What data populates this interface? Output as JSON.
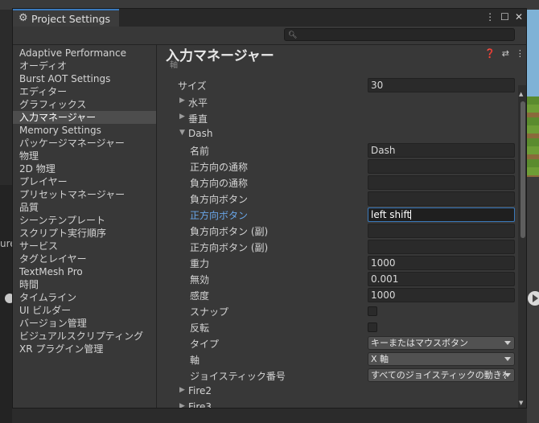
{
  "window": {
    "tab_title": "Project Settings",
    "search_placeholder": ""
  },
  "sidebar": {
    "items": [
      {
        "label": "Adaptive Performance"
      },
      {
        "label": "オーディオ"
      },
      {
        "label": "Burst AOT Settings"
      },
      {
        "label": "エディター"
      },
      {
        "label": "グラフィックス"
      },
      {
        "label": "入力マネージャー",
        "selected": true
      },
      {
        "label": "Memory Settings"
      },
      {
        "label": "パッケージマネージャー"
      },
      {
        "label": "物理"
      },
      {
        "label": "2D 物理"
      },
      {
        "label": "プレイヤー"
      },
      {
        "label": "プリセットマネージャー"
      },
      {
        "label": "品質"
      },
      {
        "label": "シーンテンプレート"
      },
      {
        "label": "スクリプト実行順序"
      },
      {
        "label": "サービス"
      },
      {
        "label": "タグとレイヤー"
      },
      {
        "label": "TextMesh Pro"
      },
      {
        "label": "時間"
      },
      {
        "label": "タイムライン"
      },
      {
        "label": "UI ビルダー"
      },
      {
        "label": "バージョン管理"
      },
      {
        "label": "ビジュアルスクリプティング"
      },
      {
        "label": "XR プラグイン管理"
      }
    ]
  },
  "content": {
    "title": "入力マネージャー",
    "axes_partial": "軸",
    "size_label": "サイズ",
    "size_value": "30",
    "horizontal_label": "水平",
    "vertical_label": "垂直",
    "dash_label": "Dash",
    "fields": {
      "name": {
        "label": "名前",
        "value": "Dash"
      },
      "positive_alias": {
        "label": "正方向の通称",
        "value": ""
      },
      "negative_alias": {
        "label": "負方向の通称",
        "value": ""
      },
      "negative_button": {
        "label": "負方向ボタン",
        "value": ""
      },
      "positive_button": {
        "label": "正方向ボタン",
        "value": "left shift"
      },
      "alt_negative_button": {
        "label": "負方向ボタン (副)",
        "value": ""
      },
      "alt_positive_button": {
        "label": "正方向ボタン (副)",
        "value": ""
      },
      "gravity": {
        "label": "重力",
        "value": "1000"
      },
      "dead": {
        "label": "無効",
        "value": "0.001"
      },
      "sensitivity": {
        "label": "感度",
        "value": "1000"
      },
      "snap": {
        "label": "スナップ",
        "checked": false
      },
      "invert": {
        "label": "反転",
        "checked": false
      },
      "type": {
        "label": "タイプ",
        "value": "キーまたはマウスボタン"
      },
      "axis": {
        "label": "軸",
        "value": "X 軸"
      },
      "joy_num": {
        "label": "ジョイスティック番号",
        "value": "すべてのジョイスティックの動きを取得"
      }
    },
    "fire2_label": "Fire2",
    "fire3_label": "Fire3"
  },
  "background": {
    "left_partial_text": "ure"
  }
}
